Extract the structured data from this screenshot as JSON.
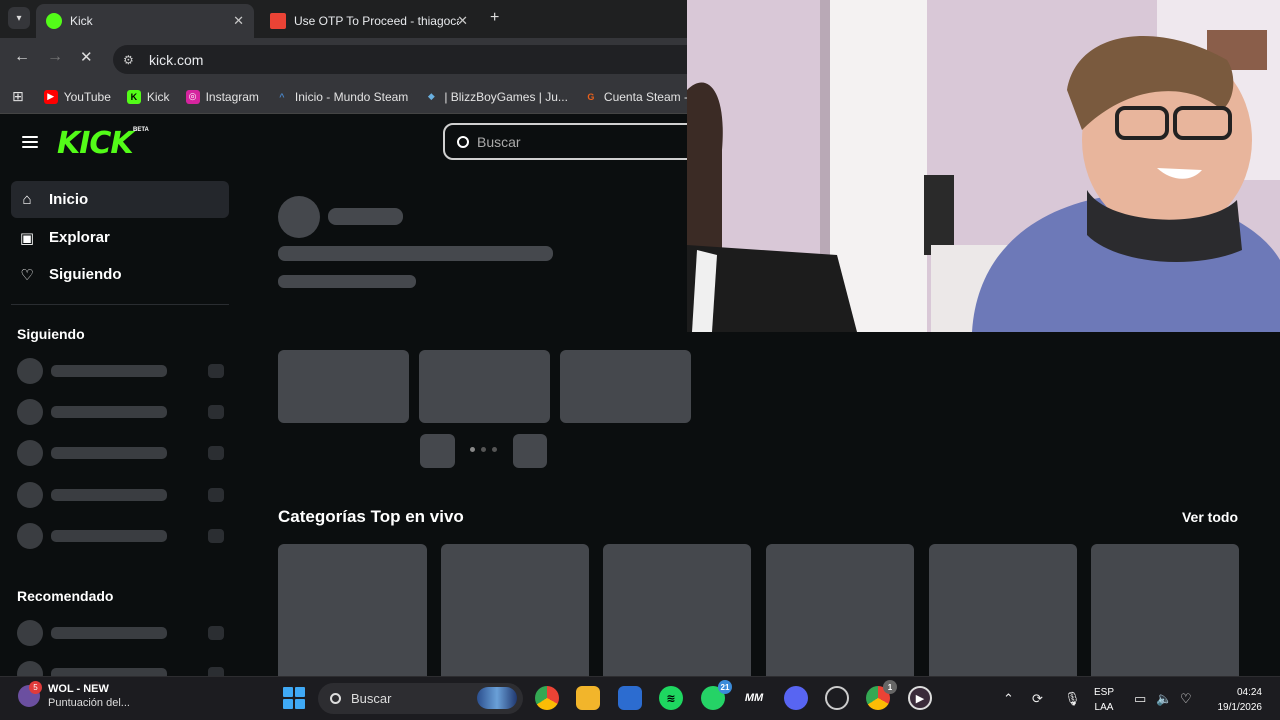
{
  "browser": {
    "tabs": [
      {
        "title": "Kick",
        "active": true,
        "favicon_color": "#53fc18"
      },
      {
        "title": "Use OTP To Proceed - thiagoca",
        "active": false,
        "favicon_color": "#ea4335"
      }
    ],
    "new_tab_symbol": "+",
    "url": "kick.com",
    "bookmarks": [
      {
        "label": "YouTube",
        "icon": "youtube-icon",
        "color": "#ff0000",
        "glyph": "▶"
      },
      {
        "label": "Kick",
        "icon": "kick-icon",
        "color": "#53fc18",
        "glyph": "K"
      },
      {
        "label": "Instagram",
        "icon": "instagram-icon",
        "color": "#d6249f",
        "glyph": "◎"
      },
      {
        "label": "Inicio - Mundo Steam",
        "icon": "mundo-steam-icon",
        "color": "#3a6fb0",
        "glyph": "^"
      },
      {
        "label": "| BlizzBoyGames | Ju...",
        "icon": "blizzboy-icon",
        "color": "#4aa3df",
        "glyph": "◆"
      },
      {
        "label": "Cuenta Steam - Gui",
        "icon": "steam-guide-icon",
        "color": "#e8601c",
        "glyph": "G"
      }
    ]
  },
  "kick": {
    "logo": "KICK",
    "beta": "BETA",
    "search_placeholder": "Buscar",
    "nav": [
      {
        "label": "Inicio",
        "icon": "home-icon",
        "glyph": "⌂",
        "active": true
      },
      {
        "label": "Explorar",
        "icon": "explore-icon",
        "glyph": "▣",
        "active": false
      },
      {
        "label": "Siguiendo",
        "icon": "heart-icon",
        "glyph": "♡",
        "active": false
      }
    ],
    "following_title": "Siguiendo",
    "recommended_title": "Recomendado",
    "section_title": "Categorías Top en vivo",
    "see_all": "Ver todo"
  },
  "taskbar": {
    "widget_title": "WOL - NEW",
    "widget_subtitle": "Puntuación del...",
    "widget_badge": "5",
    "search_placeholder": "Buscar",
    "whatsapp_badge": "21",
    "chrome_badge": "1",
    "lang_line1": "ESP",
    "lang_line2": "LAA",
    "time": "04:24",
    "date": "19/1/2026",
    "colors": {
      "accent": "#53fc18",
      "skeleton": "#45484d"
    }
  }
}
